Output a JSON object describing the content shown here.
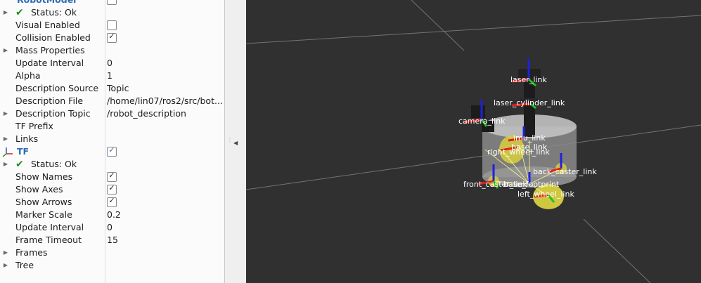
{
  "properties": {
    "robot_model": {
      "display_name": "RobotModel",
      "status_label": "Status: Ok",
      "visual_enabled_label": "Visual Enabled",
      "collision_enabled_label": "Collision Enabled",
      "mass_properties_label": "Mass Properties",
      "update_interval_label": "Update Interval",
      "update_interval_value": "0",
      "alpha_label": "Alpha",
      "alpha_value": "1",
      "description_source_label": "Description Source",
      "description_source_value": "Topic",
      "description_file_label": "Description File",
      "description_file_value": "/home/lin07/ros2/src/bot...",
      "description_topic_label": "Description Topic",
      "description_topic_value": "/robot_description",
      "tf_prefix_label": "TF Prefix",
      "links_label": "Links"
    },
    "tf": {
      "display_name": "TF",
      "status_label": "Status: Ok",
      "show_names_label": "Show Names",
      "show_axes_label": "Show Axes",
      "show_arrows_label": "Show Arrows",
      "marker_scale_label": "Marker Scale",
      "marker_scale_value": "0.2",
      "update_interval_label": "Update Interval",
      "update_interval_value": "0",
      "frame_timeout_label": "Frame Timeout",
      "frame_timeout_value": "15",
      "frames_label": "Frames",
      "tree_label": "Tree"
    },
    "checkbox_mark": "✓"
  },
  "viewport": {
    "frame_names": {
      "laser_link": "laser_link",
      "laser_cylinder_link": "laser_cylinder_link",
      "camera_link": "camera_link",
      "imu_link": "imu_link",
      "base_link": "base_link",
      "right_wheel_link": "right_wheel_link",
      "back_caster_link": "back_caster_link",
      "front_caster_link": "front_caster_link",
      "base_footprint": "base_footprint",
      "left_wheel_link": "left_wheel_link"
    },
    "colors": {
      "background": "#303030",
      "grid": "#8a8a8a",
      "x_axis": "#e02020",
      "y_axis": "#20c020",
      "z_axis": "#2020e0",
      "wheel": "#d8d040"
    }
  }
}
